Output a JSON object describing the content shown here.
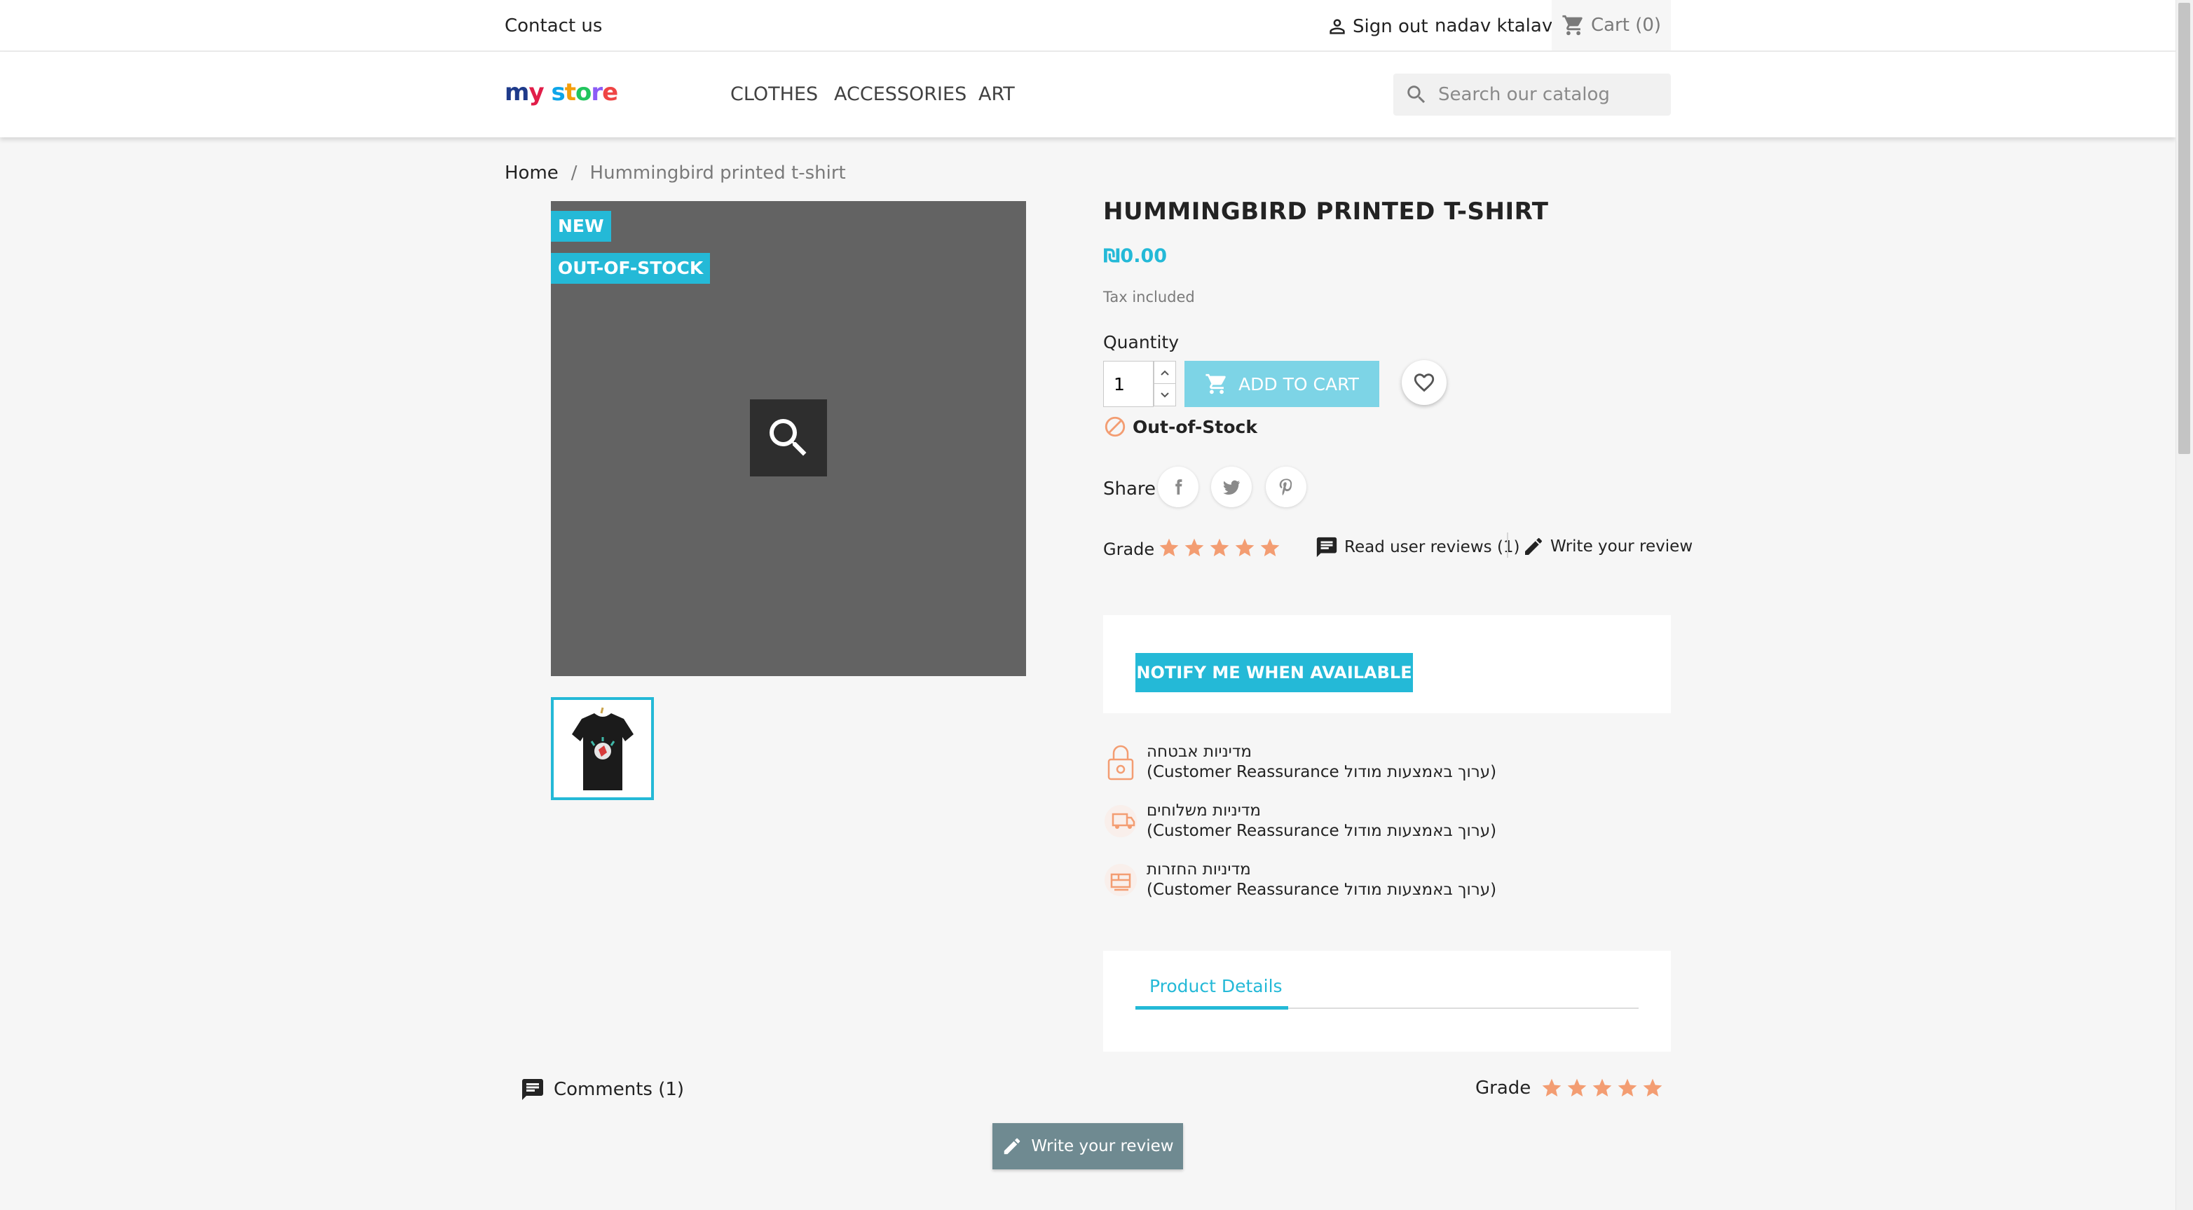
{
  "header": {
    "contact_label": "Contact us",
    "signout_label": "Sign out",
    "username": "nadav ktalav",
    "cart_label": "Cart (0)",
    "logo_text": "my store",
    "menu": [
      {
        "label": "CLOTHES"
      },
      {
        "label": "ACCESSORIES"
      },
      {
        "label": "ART"
      }
    ],
    "search_placeholder": "Search our catalog"
  },
  "breadcrumb": {
    "home": "Home",
    "separator": "/",
    "current": "Hummingbird printed t-shirt"
  },
  "gallery": {
    "flags": [
      "NEW",
      "OUT-OF-STOCK"
    ]
  },
  "product": {
    "title": "HUMMINGBIRD PRINTED T-SHIRT",
    "price": "₪0.00",
    "tax_note": "Tax included",
    "quantity_label": "Quantity",
    "quantity_value": "1",
    "add_to_cart_label": "ADD TO CART",
    "availability": "Out-of-Stock",
    "share_label": "Share",
    "grade_label": "Grade",
    "rating": 5,
    "read_reviews_label": "Read user reviews (1)",
    "write_review_label": "Write your review",
    "notify_label": "NOTIFY ME WHEN AVAILABLE"
  },
  "reassurance": [
    {
      "title": "מדיניות אבטחה",
      "subtitle": "(ערוך באמצעות מודול Customer Reassurance)",
      "icon": "lock-icon"
    },
    {
      "title": "מדיניות משלוחים",
      "subtitle": "(ערוך באמצעות מודול Customer Reassurance)",
      "icon": "truck-icon"
    },
    {
      "title": "מדיניות החזרות",
      "subtitle": "(ערוך באמצעות מודול Customer Reassurance)",
      "icon": "return-box-icon"
    }
  ],
  "tabs": {
    "product_details": "Product Details"
  },
  "comments": {
    "label": "Comments (1)",
    "grade_label": "Grade",
    "write_review_button": "Write your review"
  },
  "colors": {
    "accent": "#24b9d7",
    "star": "#f39d72",
    "oos": "#f39d72",
    "image_bg": "#636363"
  }
}
